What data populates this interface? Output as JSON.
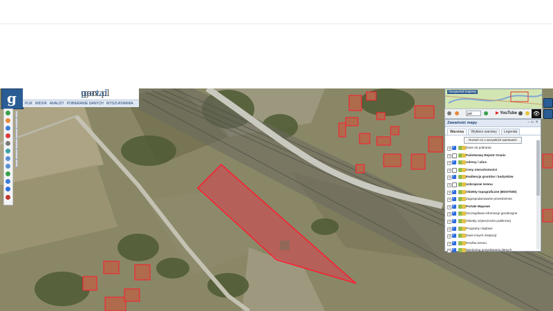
{
  "brand": {
    "prefix": "geo",
    "accent": "portal",
    "suffix": ".gov.pl",
    "logo_letter": "g"
  },
  "menu": [
    "PLIK",
    "WIDOK",
    "ANALIZY",
    "POBIERANIE DANYCH",
    "WYSZUKIWANIA"
  ],
  "minimap": {
    "title": "Geoportal krajowy"
  },
  "right_toolbar": {
    "lang": "pol",
    "youtube": "YouTube"
  },
  "layers_panel": {
    "title": "Zawartość mapy",
    "tabs": [
      "Warstwy",
      "Wybierz warstwy",
      "Legenda"
    ],
    "expand_label": "Rozwiń mi o wszystkich warstwach",
    "items": [
      {
        "label": "Dane do pobrania",
        "bold": false,
        "checked": true
      },
      {
        "label": "Państwowy Rejestr Granic",
        "bold": true,
        "checked": false
      },
      {
        "label": "Adresy i ulice",
        "bold": true,
        "checked": true
      },
      {
        "label": "Ceny nieruchomości",
        "bold": true,
        "checked": false
      },
      {
        "label": "Ewidencja gruntów i budynków",
        "bold": true,
        "checked": true
      },
      {
        "label": "Uzbrojenie terenu",
        "bold": true,
        "checked": false
      },
      {
        "label": "Obiekty topograficzne (BDOT500)",
        "bold": true,
        "checked": true
      },
      {
        "label": "Zagospodarowanie przestrzenne",
        "bold": false,
        "checked": true
      },
      {
        "label": "Portale Mapowe",
        "bold": true,
        "checked": true
      },
      {
        "label": "Szczegółowe informacje geodezyjne",
        "bold": false,
        "checked": true
      },
      {
        "label": "Obiekty użyteczności publicznej",
        "bold": false,
        "checked": true
      },
      {
        "label": "Programy rządowe",
        "bold": false,
        "checked": true
      },
      {
        "label": "Dane innych instytucji",
        "bold": false,
        "checked": true
      },
      {
        "label": "Rzeźba terenu",
        "bold": false,
        "checked": true
      },
      {
        "label": "Monitoring pozyskiwania danych",
        "bold": false,
        "checked": true
      }
    ]
  },
  "colors": {
    "parcel_fill": "#d9404f",
    "parcel_stroke": "#ff1a2e",
    "header_blue": "#2a5d94",
    "checkbox_blue": "#2d6cdf"
  }
}
